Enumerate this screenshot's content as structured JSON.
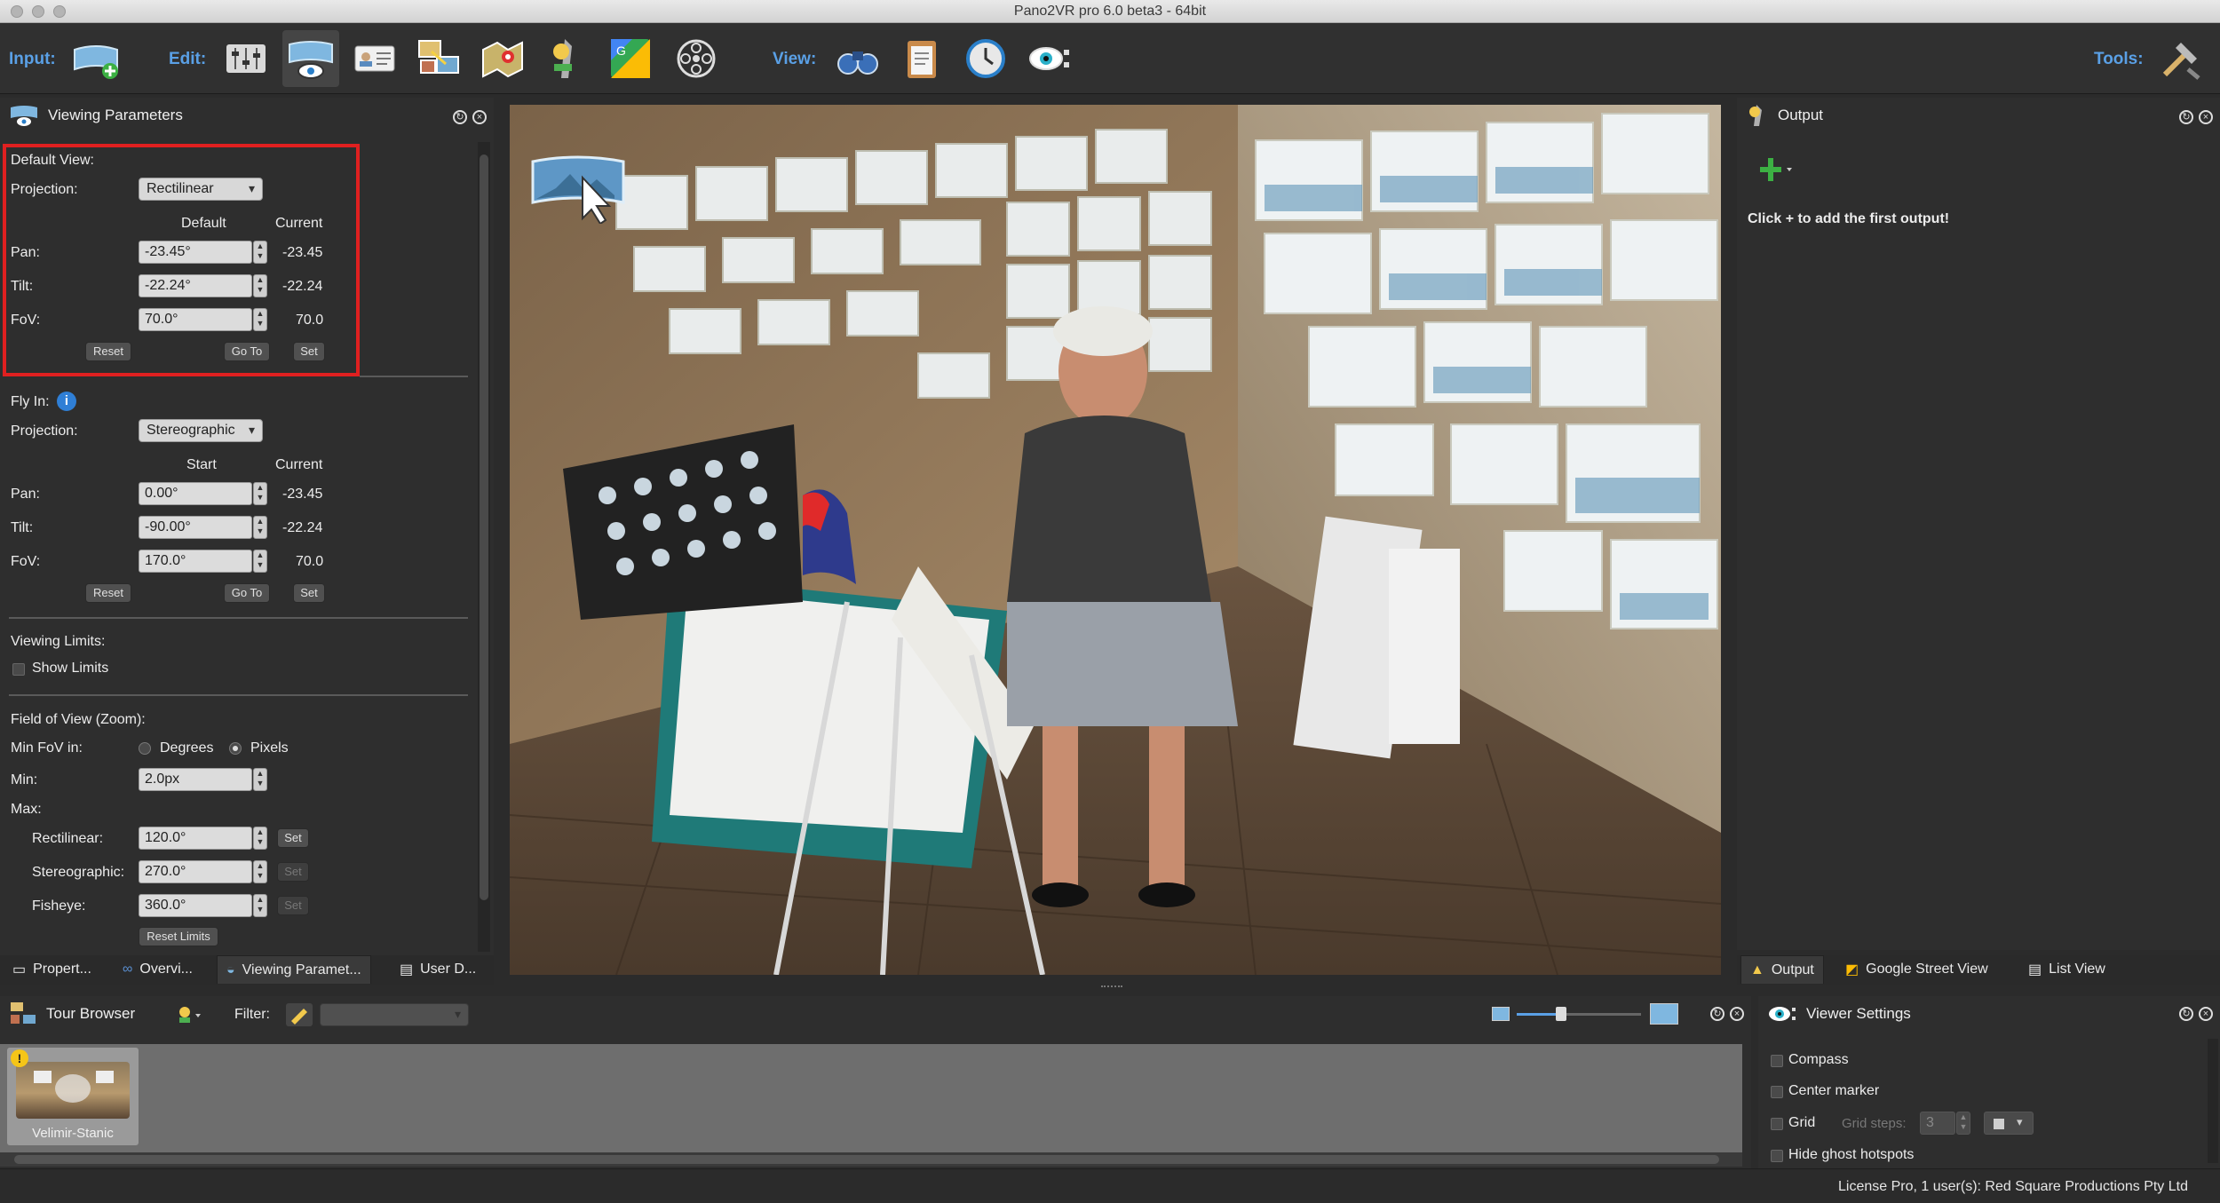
{
  "window": {
    "title": "Pano2VR pro 6.0 beta3 - 64bit"
  },
  "toolbar": {
    "input_label": "Input:",
    "edit_label": "Edit:",
    "view_label": "View:",
    "tools_label": "Tools:"
  },
  "viewing_params": {
    "title": "Viewing Parameters",
    "default_view": {
      "heading": "Default View:",
      "projection_label": "Projection:",
      "projection_value": "Rectilinear",
      "col_default": "Default",
      "col_current": "Current",
      "pan_label": "Pan:",
      "pan_value": "-23.45°",
      "pan_current": "-23.45",
      "tilt_label": "Tilt:",
      "tilt_value": "-22.24°",
      "tilt_current": "-22.24",
      "fov_label": "FoV:",
      "fov_value": "70.0°",
      "fov_current": "70.0",
      "reset": "Reset",
      "goto": "Go To",
      "set": "Set"
    },
    "fly_in": {
      "heading": "Fly In:",
      "projection_label": "Projection:",
      "projection_value": "Stereographic",
      "col_start": "Start",
      "col_current": "Current",
      "pan_label": "Pan:",
      "pan_value": "0.00°",
      "pan_current": "-23.45",
      "tilt_label": "Tilt:",
      "tilt_value": "-90.00°",
      "tilt_current": "-22.24",
      "fov_label": "FoV:",
      "fov_value": "170.0°",
      "fov_current": "70.0",
      "reset": "Reset",
      "goto": "Go To",
      "set": "Set"
    },
    "limits": {
      "heading": "Viewing Limits:",
      "show_limits": "Show Limits"
    },
    "zoom": {
      "heading": "Field of View (Zoom):",
      "min_fov_label": "Min FoV in:",
      "degrees": "Degrees",
      "pixels": "Pixels",
      "min_label": "Min:",
      "min_value": "2.0px",
      "max_label": "Max:",
      "rect_label": "Rectilinear:",
      "rect_value": "120.0°",
      "stereo_label": "Stereographic:",
      "stereo_value": "270.0°",
      "fisheye_label": "Fisheye:",
      "fisheye_value": "360.0°",
      "set": "Set",
      "reset_limits": "Reset Limits"
    }
  },
  "left_tabs": [
    "Propert...",
    "Overvi...",
    "Viewing Paramet...",
    "User D..."
  ],
  "output": {
    "title": "Output",
    "hint": "Click + to add the first output!"
  },
  "right_tabs": [
    "Output",
    "Google Street View",
    "List View"
  ],
  "tour_browser": {
    "title": "Tour Browser",
    "filter_label": "Filter:",
    "thumb_label": "Velimir-Stanic",
    "thumb_badge": "!"
  },
  "viewer_settings": {
    "title": "Viewer Settings",
    "compass": "Compass",
    "center_marker": "Center marker",
    "grid": "Grid",
    "grid_steps_label": "Grid steps:",
    "grid_steps_value": "3",
    "hide_ghost": "Hide ghost hotspots"
  },
  "status": {
    "license": "License Pro, 1 user(s): Red Square Productions Pty Ltd"
  },
  "colors": {
    "accent_blue": "#5aa0e6",
    "highlight_red": "#e02020",
    "panel": "#2e2e2e"
  }
}
